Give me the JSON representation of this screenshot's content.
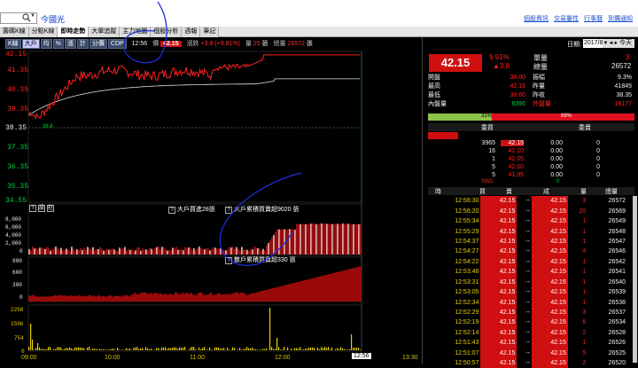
{
  "toolbar": {
    "symbol_value": "",
    "stock_name": "今國光",
    "links": [
      "個股資訊",
      "交易屬性",
      "行事曆",
      "到價通知"
    ]
  },
  "tabs": [
    {
      "label": "籌碼K線",
      "active": false
    },
    {
      "label": "分點K線",
      "active": false
    },
    {
      "label": "即時走勢",
      "active": true
    },
    {
      "label": "大單追蹤",
      "active": false
    },
    {
      "label": "主力地圖",
      "active": false
    },
    {
      "label": "個股分析",
      "active": false
    },
    {
      "label": "週報",
      "active": false
    },
    {
      "label": "筆記",
      "active": false
    }
  ],
  "chart_toolbar": {
    "buttons": [
      "K線",
      "大戶",
      "均",
      "%",
      "漲",
      "計",
      "分價",
      "CDP"
    ],
    "selected_button": "大戶",
    "time": "12:56",
    "price_label": "價",
    "price_value": "42.15",
    "change_label": "漲跌",
    "change_value": "+3.8 (+9.91%)",
    "volume_label": "量",
    "volume_value": "25",
    "volume_unit": "張",
    "total_label": "總量",
    "total_value": "26572",
    "total_unit": "張"
  },
  "price_axis": {
    "labels_red": [
      "42.15",
      "41.35",
      "40.35",
      "39.35"
    ],
    "ref_label": "38.35",
    "labels_green": [
      "37.35",
      "36.35",
      "35.35",
      "34.55"
    ],
    "low_mark": "38.6"
  },
  "panel2": {
    "btns": [
      "?",
      "設",
      "柱"
    ],
    "title": "大戶買進28張",
    "title2": "大戶累積買賣超9020 張",
    "axis": [
      "8,000",
      "6,000",
      "4,000",
      "2,000",
      "0"
    ]
  },
  "panel3": {
    "title": "散戶累積買賣超330 張",
    "axis": [
      "900",
      "600",
      "300",
      "0"
    ]
  },
  "panel4": {
    "axis": [
      "2258",
      "1506",
      "754",
      "0"
    ]
  },
  "time_axis": {
    "labels": [
      "09:00",
      "10:00",
      "11:00",
      "12:00",
      "13:30"
    ],
    "cursor": "12:56"
  },
  "right": {
    "date_label": "日期:",
    "date_value": "2017/8/28",
    "today_label": "今天",
    "big_price": "42.15",
    "pct": "9.91%",
    "chg": "▲3.8",
    "unit_label": "單量",
    "unit_value": "3",
    "total_label": "總量",
    "total_value": "26572",
    "stats": [
      {
        "l": "開盤",
        "v": "38.00",
        "l2": "振幅",
        "v2": "9.3%"
      },
      {
        "l": "最高",
        "v": "42.15",
        "l2": "昨量",
        "v2": "41845"
      },
      {
        "l": "最低",
        "v": "38.60",
        "l2": "昨收",
        "v2": "38.35"
      },
      {
        "l": "內盤量",
        "v": "8395",
        "l2": "外盤量",
        "v2": "18177"
      }
    ],
    "ratio_left": "31%",
    "ratio_right": "69%",
    "ratio_value": 0.31,
    "book_head": [
      "委買",
      "委賣"
    ],
    "book": [
      {
        "bq": "",
        "bp": "",
        "sp": "",
        "sq": ""
      },
      {
        "bq": "3965",
        "bp": "42.15",
        "sp": "0.00",
        "sq": "0"
      },
      {
        "bq": "16",
        "bp": "42.10",
        "sp": "0.00",
        "sq": "0"
      },
      {
        "bq": "1",
        "bp": "42.05",
        "sp": "0.00",
        "sq": "0"
      },
      {
        "bq": "5",
        "bp": "42.00",
        "sp": "0.00",
        "sq": "0"
      },
      {
        "bq": "5",
        "bp": "41.95",
        "sp": "0.00",
        "sq": "0"
      }
    ],
    "book_total_buy": "3992",
    "book_total_sell": "0",
    "tick_head": [
      "時",
      "買",
      "賣",
      "成",
      "量",
      "總量"
    ],
    "ticks": [
      {
        "t": "12:56:30",
        "b": "42.15",
        "s": "--",
        "p": "42.15",
        "v": "3",
        "tot": "26572"
      },
      {
        "t": "12:56:20",
        "b": "42.15",
        "s": "--",
        "p": "42.15",
        "v": "20",
        "tot": "26569"
      },
      {
        "t": "12:55:34",
        "b": "42.15",
        "s": "--",
        "p": "42.15",
        "v": "1",
        "tot": "26549"
      },
      {
        "t": "12:55:29",
        "b": "42.15",
        "s": "--",
        "p": "42.15",
        "v": "1",
        "tot": "26548"
      },
      {
        "t": "12:54:37",
        "b": "42.15",
        "s": "--",
        "p": "42.15",
        "v": "1",
        "tot": "26547"
      },
      {
        "t": "12:54:27",
        "b": "42.15",
        "s": "--",
        "p": "42.15",
        "v": "4",
        "tot": "26546"
      },
      {
        "t": "12:54:22",
        "b": "42.15",
        "s": "--",
        "p": "42.15",
        "v": "1",
        "tot": "26542"
      },
      {
        "t": "12:53:46",
        "b": "42.15",
        "s": "--",
        "p": "42.15",
        "v": "1",
        "tot": "26541"
      },
      {
        "t": "12:53:31",
        "b": "42.15",
        "s": "--",
        "p": "42.15",
        "v": "1",
        "tot": "26540"
      },
      {
        "t": "12:53:05",
        "b": "42.15",
        "s": "--",
        "p": "42.15",
        "v": "1",
        "tot": "26539"
      },
      {
        "t": "12:52:34",
        "b": "42.15",
        "s": "--",
        "p": "42.15",
        "v": "1",
        "tot": "26538"
      },
      {
        "t": "12:52:29",
        "b": "42.15",
        "s": "--",
        "p": "42.15",
        "v": "3",
        "tot": "26537"
      },
      {
        "t": "12:52:19",
        "b": "42.15",
        "s": "--",
        "p": "42.15",
        "v": "6",
        "tot": "26534"
      },
      {
        "t": "12:52:14",
        "b": "42.15",
        "s": "--",
        "p": "42.15",
        "v": "2",
        "tot": "26528"
      },
      {
        "t": "12:51:43",
        "b": "42.15",
        "s": "--",
        "p": "42.15",
        "v": "1",
        "tot": "26526"
      },
      {
        "t": "12:51:07",
        "b": "42.15",
        "s": "--",
        "p": "42.15",
        "v": "5",
        "tot": "26525"
      },
      {
        "t": "12:50:57",
        "b": "42.15",
        "s": "--",
        "p": "42.15",
        "v": "2",
        "tot": "26520"
      }
    ]
  },
  "colors": {
    "up": "#ff2020",
    "down": "#00d040",
    "ref": "#eeeeee",
    "accent": "#d01010"
  }
}
